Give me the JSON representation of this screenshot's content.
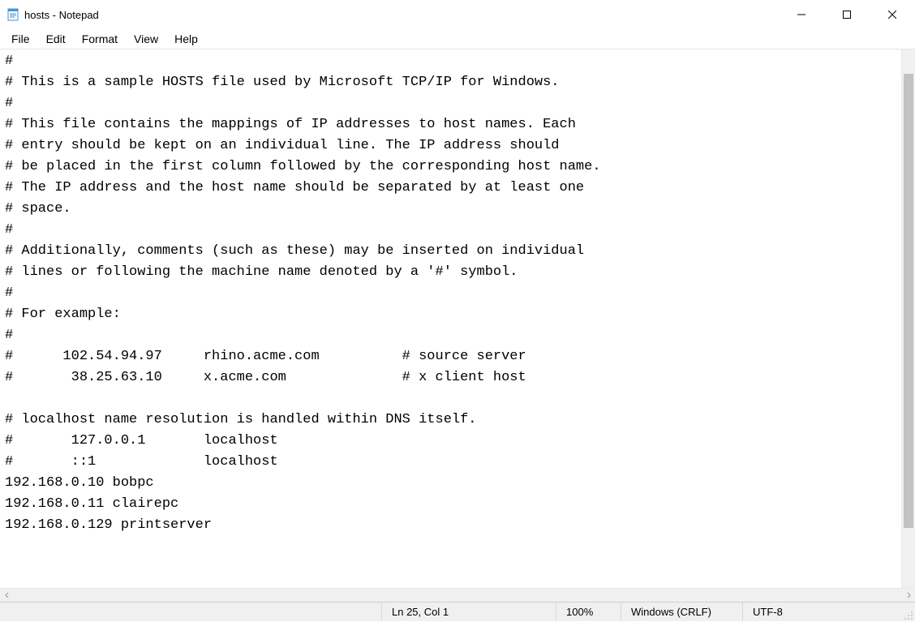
{
  "window": {
    "title": "hosts - Notepad"
  },
  "menu": {
    "file": "File",
    "edit": "Edit",
    "format": "Format",
    "view": "View",
    "help": "Help"
  },
  "editor": {
    "content": "#\n# This is a sample HOSTS file used by Microsoft TCP/IP for Windows.\n#\n# This file contains the mappings of IP addresses to host names. Each\n# entry should be kept on an individual line. The IP address should\n# be placed in the first column followed by the corresponding host name.\n# The IP address and the host name should be separated by at least one\n# space.\n#\n# Additionally, comments (such as these) may be inserted on individual\n# lines or following the machine name denoted by a '#' symbol.\n#\n# For example:\n#\n#      102.54.94.97     rhino.acme.com          # source server\n#       38.25.63.10     x.acme.com              # x client host\n\n# localhost name resolution is handled within DNS itself.\n#       127.0.0.1       localhost\n#       ::1             localhost\n192.168.0.10 bobpc\n192.168.0.11 clairepc\n192.168.0.129 printserver\n"
  },
  "status": {
    "position": "Ln 25, Col 1",
    "zoom": "100%",
    "line_ending": "Windows (CRLF)",
    "encoding": "UTF-8"
  }
}
